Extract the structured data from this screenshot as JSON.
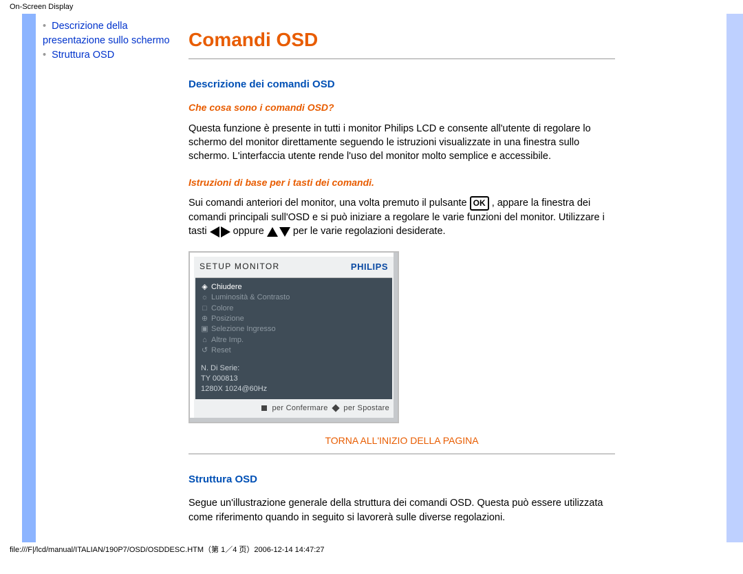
{
  "meta_top": "On-Screen Display",
  "meta_foot": "file:///F|/lcd/manual/ITALIAN/190P7/OSD/OSDDESC.HTM（第 1／4 页）2006-12-14 14:47:27",
  "sidebar": {
    "items": [
      {
        "label": "Descrizione della presentazione sullo schermo"
      },
      {
        "label": "Struttura OSD"
      }
    ]
  },
  "page": {
    "title": "Comandi OSD",
    "section1": {
      "heading": "Descrizione dei comandi OSD",
      "sub1": "Che cosa sono i comandi OSD?",
      "para1": "Questa funzione è presente in tutti i monitor Philips LCD e consente all'utente di regolare lo schermo del monitor direttamente seguendo le istruzioni visualizzate in una finestra sullo schermo. L'interfaccia utente rende l'uso del monitor molto semplice e accessibile.",
      "sub2": "Istruzioni di base per i tasti dei comandi.",
      "para2a": "Sui comandi anteriori del monitor, una volta premuto il pulsante ",
      "ok_label": "OK",
      "para2b": " , appare la finestra dei comandi principali sull'OSD e si può iniziare a regolare le varie funzioni del monitor. Utilizzare i tasti ",
      "para2c": " oppure ",
      "para2d": " per le varie regolazioni desiderate."
    },
    "osd": {
      "setup": "SETUP MONITOR",
      "brand": "PHILIPS",
      "items": [
        {
          "sym": "◈",
          "label": "Chiudere",
          "active": true
        },
        {
          "sym": "☼",
          "label": "Luminosità & Contrasto",
          "active": false
        },
        {
          "sym": "□",
          "label": "Colore",
          "active": false
        },
        {
          "sym": "⊕",
          "label": "Posizione",
          "active": false
        },
        {
          "sym": "▣",
          "label": "Selezione Ingresso",
          "active": false
        },
        {
          "sym": "⌂",
          "label": "Altre Imp.",
          "active": false
        },
        {
          "sym": "↺",
          "label": "Reset",
          "active": false
        }
      ],
      "serial1": "N. Di Serie:",
      "serial2": "   TY 000813",
      "res": "1280X 1024@60Hz",
      "foot_confirm": "per Confermare",
      "foot_move": "per Spostare"
    },
    "back_top": "TORNA ALL'INIZIO DELLA PAGINA",
    "section2": {
      "heading": "Struttura OSD",
      "para": "Segue un'illustrazione generale della struttura dei comandi OSD. Questa può essere utilizzata come riferimento quando in seguito si lavorerà sulle diverse regolazioni."
    }
  }
}
